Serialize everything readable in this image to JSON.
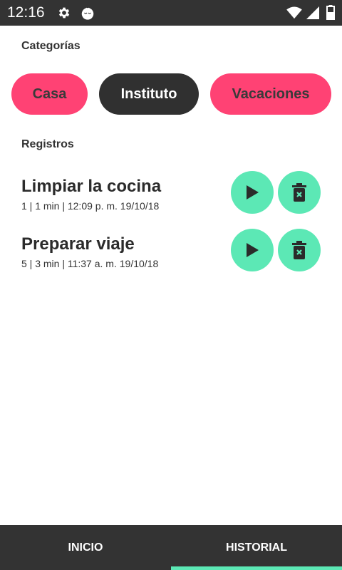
{
  "status_bar": {
    "time": "12:16",
    "icons": [
      "gear-icon",
      "tomato-icon",
      "wifi-icon",
      "signal-icon",
      "battery-icon"
    ]
  },
  "categories": {
    "title": "Categorías",
    "items": [
      {
        "label": "Casa",
        "color": "#ff4274",
        "selected": false
      },
      {
        "label": "Instituto",
        "color": "#303030",
        "selected": true
      },
      {
        "label": "Vacaciones",
        "color": "#ff4274",
        "selected": false
      }
    ]
  },
  "records": {
    "title": "Registros",
    "items": [
      {
        "title": "Limpiar la cocina",
        "meta": "1 | 1 min | 12:09 p. m. 19/10/18"
      },
      {
        "title": "Preparar viaje",
        "meta": "5 | 3 min | 11:37 a. m. 19/10/18"
      }
    ],
    "action_icons": [
      "play-icon",
      "delete-icon"
    ]
  },
  "bottom_nav": {
    "tabs": [
      {
        "label": "INICIO",
        "active": false
      },
      {
        "label": "HISTORIAL",
        "active": true
      }
    ]
  },
  "colors": {
    "accent": "#5ce8b5",
    "pink": "#ff4274",
    "dark": "#333333"
  }
}
